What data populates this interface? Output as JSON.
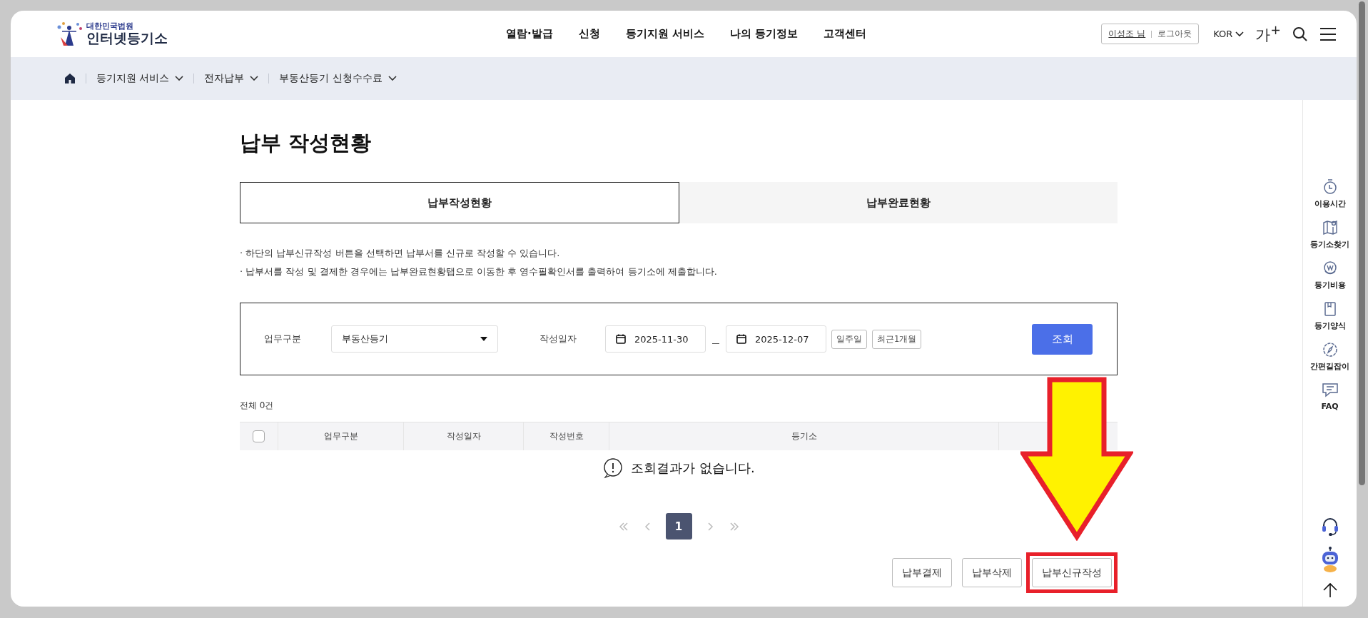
{
  "header": {
    "logo": {
      "org": "대한민국법원",
      "name": "인터넷등기소"
    },
    "nav": [
      "열람·발급",
      "신청",
      "등기지원 서비스",
      "나의 등기정보",
      "고객센터"
    ],
    "user": {
      "name": "이성조 님",
      "logout": "로그아웃"
    },
    "language": "KOR",
    "font_size": "가$^{+}$"
  },
  "breadcrumb": [
    "등기지원 서비스",
    "전자납부",
    "부동산등기 신청수수료"
  ],
  "page_title": "납부 작성현황",
  "tabs": [
    {
      "label": "납부작성현황",
      "selected": true
    },
    {
      "label": "납부완료현황",
      "selected": false
    }
  ],
  "notes": [
    "· 하단의 납부신규작성 버튼을 선택하면 납부서를 신규로 작성할 수 있습니다.",
    "· 납부서를 작성 및 결제한 경우에는 납부완료현황탭으로 이동한 후 영수필확인서를 출력하여 등기소에 제출합니다."
  ],
  "filter": {
    "category_label": "업무구분",
    "category_value": "부동산등기",
    "date_label": "작성일자",
    "date_from": "2025-11-30",
    "date_to": "2025-12-07",
    "quick_ranges": [
      "일주일",
      "최근1개월"
    ],
    "search_button": "조회"
  },
  "table": {
    "total": "전체 0건",
    "select_all_checked": false,
    "columns": [
      "업무구분",
      "작성일자",
      "작성번호",
      "등기소"
    ],
    "empty_message": "조회결과가 없습니다."
  },
  "pagination": {
    "pages": [
      {
        "label": "1",
        "selected": true
      }
    ]
  },
  "actions": [
    {
      "label": "납부결제",
      "highlighted": false
    },
    {
      "label": "납부삭제",
      "highlighted": false
    },
    {
      "label": "납부신규작성",
      "highlighted": true
    }
  ],
  "quick_menu": [
    {
      "kind": "stopwatch",
      "label": "이용시간"
    },
    {
      "kind": "map",
      "label": "등기소찾기"
    },
    {
      "kind": "coin",
      "label": "등기비용"
    },
    {
      "kind": "book",
      "label": "등기양식"
    },
    {
      "kind": "compass",
      "label": "간편길잡이"
    },
    {
      "kind": "chat",
      "label": "FAQ"
    }
  ]
}
